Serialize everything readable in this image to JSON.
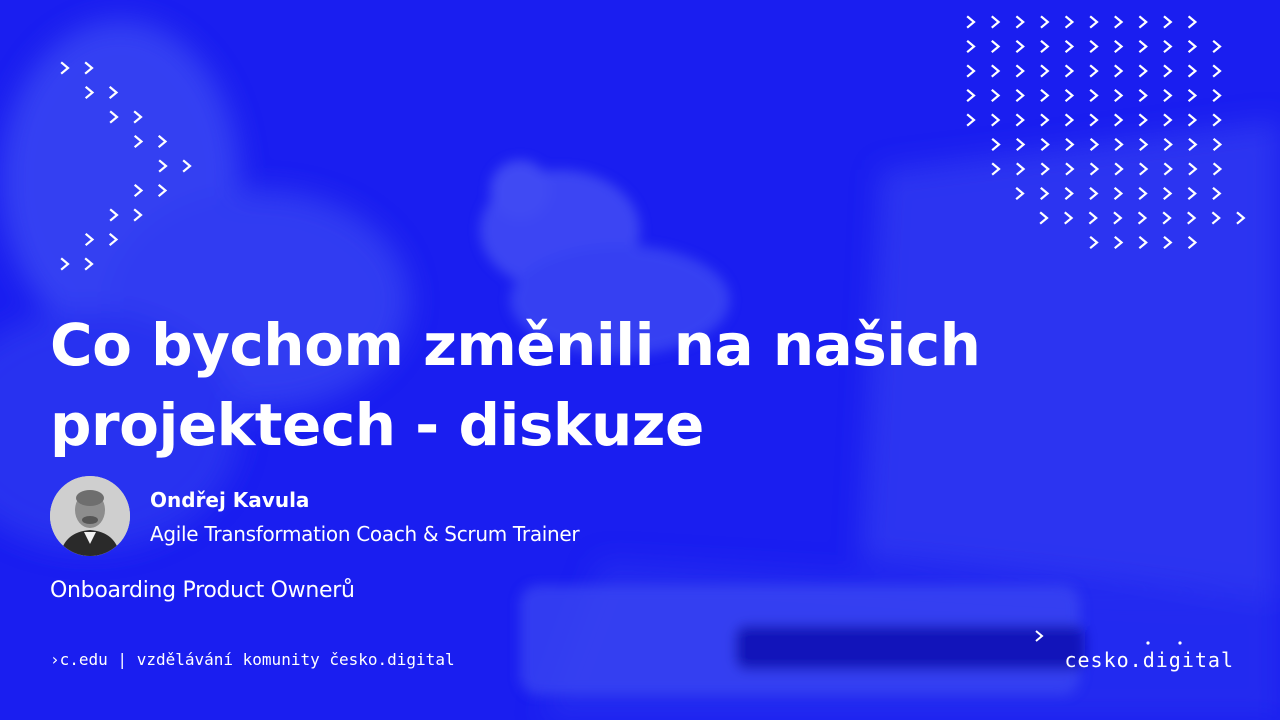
{
  "talk": {
    "title_line1": "Co bychom změnili na našich",
    "title_line2": "projektech - diskuze"
  },
  "speaker": {
    "name": "Ondřej Kavula",
    "role": "Agile Transformation Coach & Scrum Trainer"
  },
  "course": "Onboarding Product Ownerů",
  "footer": "›c.edu | vzdělávání komunity česko.digital",
  "logo": {
    "text": "cesko.digital"
  },
  "colors": {
    "background": "#1a1ef0",
    "text": "#ffffff"
  },
  "icons": {
    "pattern_glyph": "chevron-right-icon",
    "logo_glyph": "chevron-right-icon"
  }
}
